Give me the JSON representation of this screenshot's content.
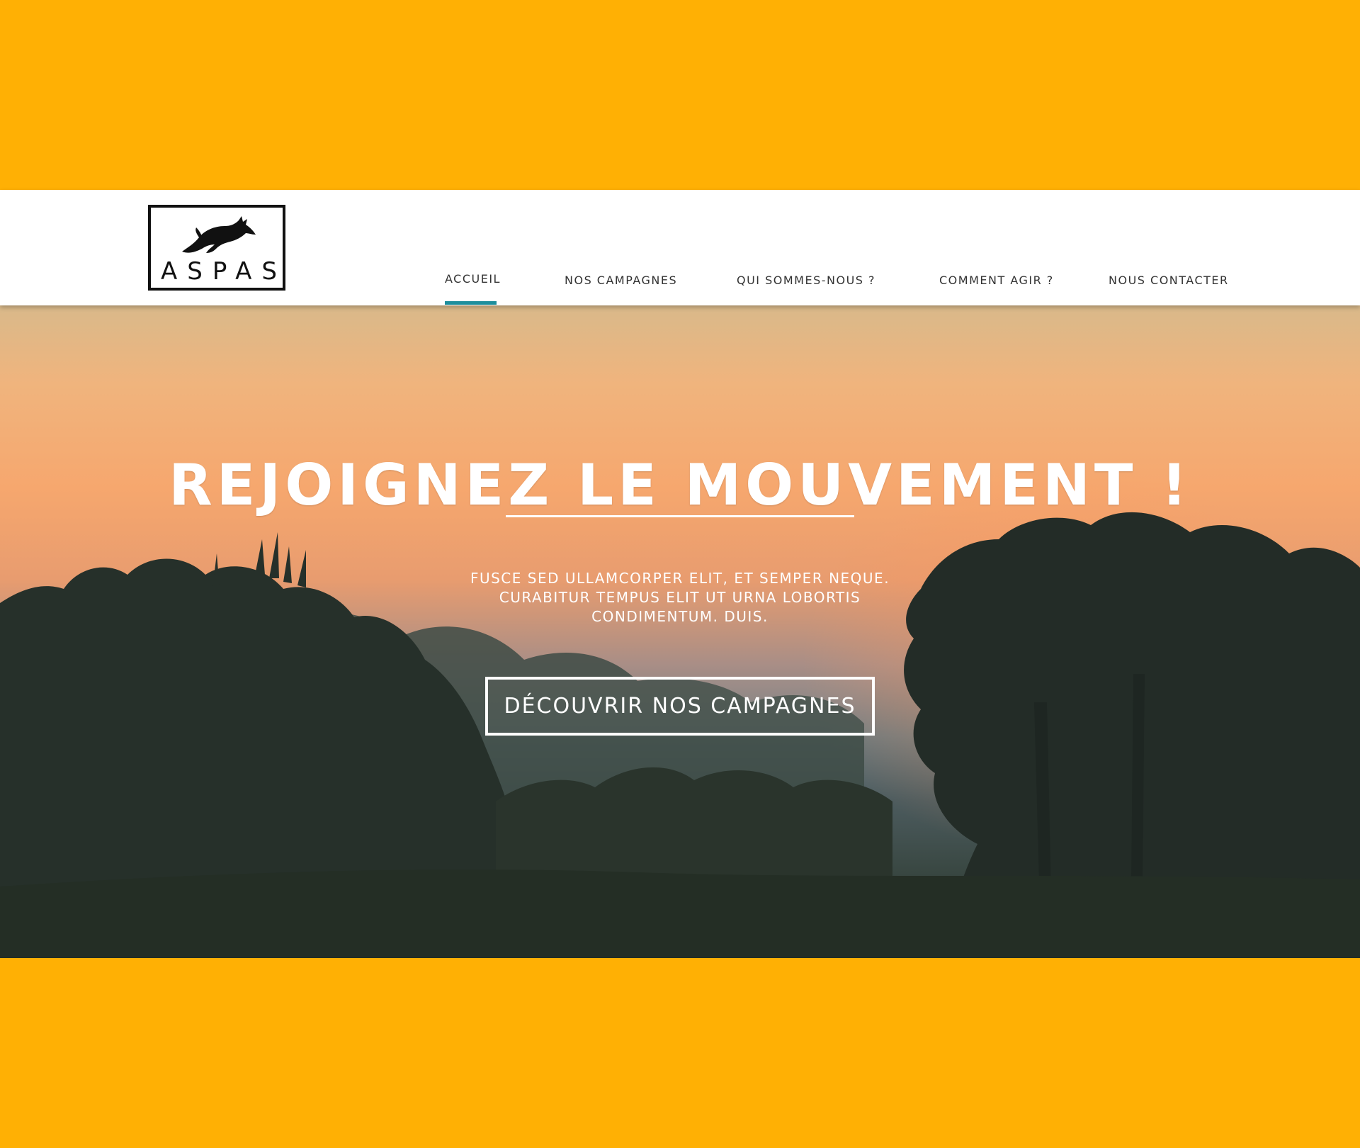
{
  "brand": {
    "logo_text": "ASPAS",
    "logo_icon": "leaping-fox-icon"
  },
  "nav": {
    "items": [
      {
        "label": "ACCUEIL",
        "active": true
      },
      {
        "label": "NOS CAMPAGNES",
        "active": false
      },
      {
        "label": "QUI SOMMES-NOUS ?",
        "active": false
      },
      {
        "label": "COMMENT AGIR ?",
        "active": false
      },
      {
        "label": "NOUS CONTACTER",
        "active": false
      }
    ],
    "active_color": "#1D8E9C"
  },
  "hero": {
    "title": "REJOIGNEZ LE MOUVEMENT !",
    "text": "FUSCE SED ULLAMCORPER ELIT, ET SEMPER NEQUE. CURABITUR TEMPUS ELIT UT URNA LOBORTIS CONDIMENTUM. DUIS.",
    "cta_label": "DÉCOUVRIR NOS CAMPAGNES"
  },
  "colors": {
    "frame_background": "#FFB004",
    "header_background": "#FFFFFF",
    "text_dark": "#333333",
    "text_light": "#FFFFFF"
  }
}
